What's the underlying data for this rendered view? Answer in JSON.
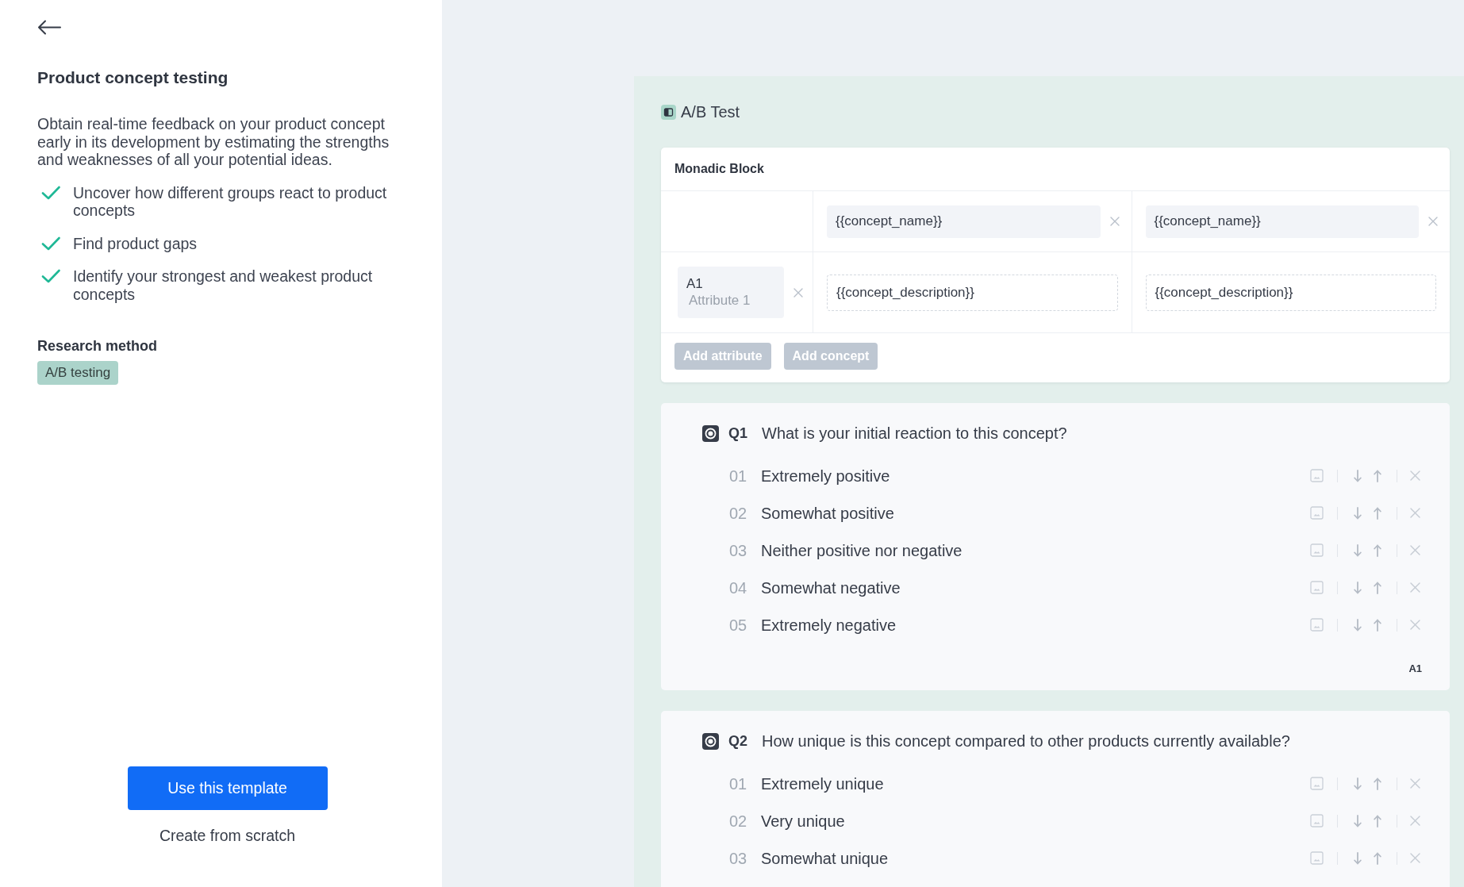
{
  "sidebar": {
    "title": "Product concept testing",
    "description": "Obtain real-time feedback on your product concept early in its development by estimating the strengths and weaknesses of all your potential ideas.",
    "benefits": [
      "Uncover how different groups react to product concepts",
      "Find product gaps",
      "Identify your strongest and weakest product concepts"
    ],
    "research_method": {
      "heading": "Research method",
      "tag": "A/B testing"
    },
    "primary_button": "Use this template",
    "secondary_link": "Create from scratch"
  },
  "editor": {
    "title": "A/B Test",
    "block": {
      "title": "Monadic Block",
      "concepts": [
        {
          "name": "{{concept_name}}",
          "description": "{{concept_description}}"
        },
        {
          "name": "{{concept_name}}",
          "description": "{{concept_description}}"
        }
      ],
      "attributes": [
        {
          "code": "A1",
          "placeholder": "Attribute 1"
        }
      ],
      "buttons": [
        {
          "label": "Add attribute",
          "disabled": true
        },
        {
          "label": "Add concept",
          "disabled": true
        }
      ]
    },
    "questions": [
      {
        "number": "Q1",
        "text": "What is your initial reaction to this concept?",
        "options": [
          {
            "number": "01",
            "label": "Extremely positive"
          },
          {
            "number": "02",
            "label": "Somewhat positive"
          },
          {
            "number": "03",
            "label": "Neither positive nor negative"
          },
          {
            "number": "04",
            "label": "Somewhat negative"
          },
          {
            "number": "05",
            "label": "Extremely negative"
          }
        ],
        "attribute_tag": "A1"
      },
      {
        "number": "Q2",
        "text": "How unique is this concept compared to other products currently available?",
        "options": [
          {
            "number": "01",
            "label": "Extremely unique"
          },
          {
            "number": "02",
            "label": "Very unique"
          },
          {
            "number": "03",
            "label": "Somewhat unique"
          }
        ]
      }
    ]
  }
}
